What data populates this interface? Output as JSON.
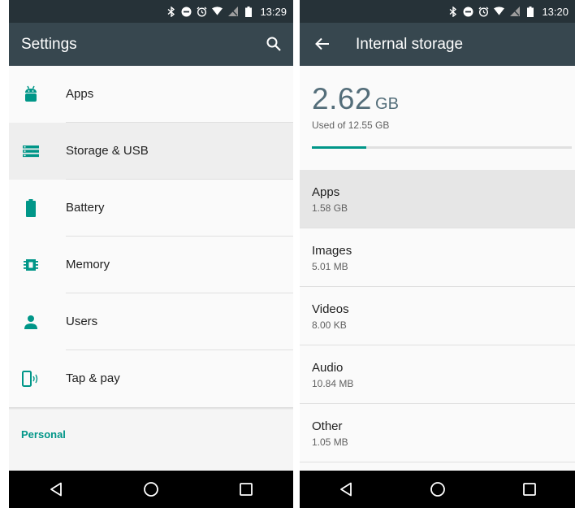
{
  "left_screen": {
    "status_bar": {
      "time": "13:29"
    },
    "app_bar": {
      "title": "Settings",
      "search_icon": "search-icon"
    },
    "items": [
      {
        "label": "Apps",
        "icon": "android-icon",
        "active": false
      },
      {
        "label": "Storage & USB",
        "icon": "storage-icon",
        "active": true
      },
      {
        "label": "Battery",
        "icon": "battery-icon",
        "active": false
      },
      {
        "label": "Memory",
        "icon": "memory-chip-icon",
        "active": false
      },
      {
        "label": "Users",
        "icon": "person-icon",
        "active": false
      },
      {
        "label": "Tap & pay",
        "icon": "tap-pay-icon",
        "active": false
      }
    ],
    "section_header": "Personal"
  },
  "right_screen": {
    "status_bar": {
      "time": "13:20"
    },
    "app_bar": {
      "title": "Internal storage",
      "back_icon": "arrow-back-icon"
    },
    "storage": {
      "used_value": "2.62",
      "used_unit": "GB",
      "used_of_total": "Used of 12.55 GB",
      "progress_fraction": 0.21
    },
    "categories": [
      {
        "label": "Apps",
        "size": "1.58 GB",
        "active": true
      },
      {
        "label": "Images",
        "size": "5.01 MB",
        "active": false
      },
      {
        "label": "Videos",
        "size": "8.00 KB",
        "active": false
      },
      {
        "label": "Audio",
        "size": "10.84 MB",
        "active": false
      },
      {
        "label": "Other",
        "size": "1.05 MB",
        "active": false
      }
    ]
  },
  "nav_bar": {
    "icons": [
      "back-triangle-icon",
      "home-circle-icon",
      "recents-square-icon"
    ]
  },
  "colors": {
    "accent": "#009688",
    "status_bar": "#263238",
    "app_bar": "#37474f",
    "storage_text": "#546e7a"
  }
}
